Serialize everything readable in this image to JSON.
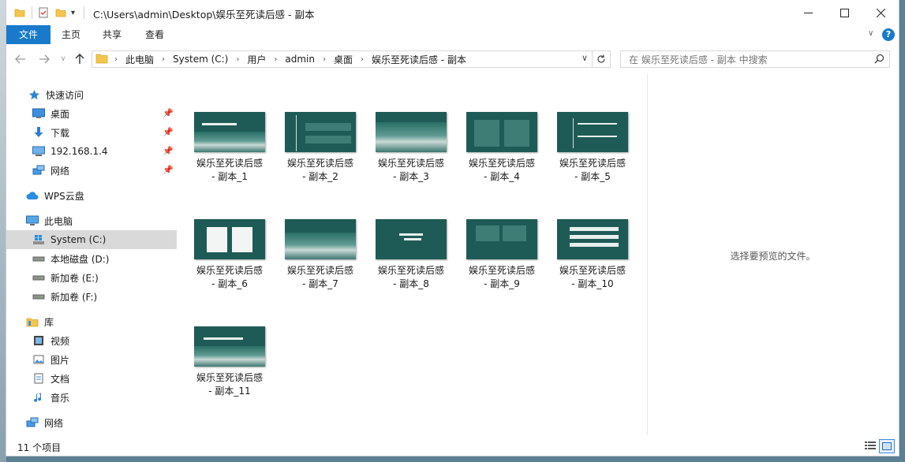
{
  "window": {
    "title": "C:\\Users\\admin\\Desktop\\娱乐至死读后感 - 副本"
  },
  "ribbon": {
    "tabs": [
      {
        "label": "文件",
        "active": true
      },
      {
        "label": "主页"
      },
      {
        "label": "共享"
      },
      {
        "label": "查看"
      }
    ]
  },
  "address": {
    "breadcrumbs": [
      "此电脑",
      "System (C:)",
      "用户",
      "admin",
      "桌面",
      "娱乐至死读后感 - 副本"
    ]
  },
  "search": {
    "placeholder": "在 娱乐至死读后感 - 副本 中搜索"
  },
  "sidebar": {
    "items": [
      {
        "label": "快速访问",
        "icon": "star-icon",
        "indent": 0
      },
      {
        "label": "桌面",
        "icon": "desktop-icon",
        "indent": 1,
        "pinned": true
      },
      {
        "label": "下载",
        "icon": "download-icon",
        "indent": 1,
        "pinned": true
      },
      {
        "label": "192.168.1.4",
        "icon": "monitor-icon",
        "indent": 1,
        "pinned": true
      },
      {
        "label": "网络",
        "icon": "network-icon",
        "indent": 1,
        "pinned": true
      },
      {
        "label": "WPS云盘",
        "icon": "cloud-icon",
        "indent": 0
      },
      {
        "label": "此电脑",
        "icon": "computer-icon",
        "indent": 0
      },
      {
        "label": "System (C:)",
        "icon": "windows-drive-icon",
        "indent": 1,
        "selected": true
      },
      {
        "label": "本地磁盘 (D:)",
        "icon": "drive-icon",
        "indent": 1
      },
      {
        "label": "新加卷 (E:)",
        "icon": "drive-icon",
        "indent": 1
      },
      {
        "label": "新加卷 (F:)",
        "icon": "drive-icon",
        "indent": 1
      },
      {
        "label": "库",
        "icon": "library-icon",
        "indent": 0
      },
      {
        "label": "视频",
        "icon": "video-icon",
        "indent": 1
      },
      {
        "label": "图片",
        "icon": "picture-icon",
        "indent": 1
      },
      {
        "label": "文档",
        "icon": "document-icon",
        "indent": 1
      },
      {
        "label": "音乐",
        "icon": "music-icon",
        "indent": 1
      },
      {
        "label": "网络",
        "icon": "network-icon",
        "indent": 0
      }
    ]
  },
  "files": [
    {
      "line1": "娱乐至死读后感",
      "line2": "- 副本_1"
    },
    {
      "line1": "娱乐至死读后感",
      "line2": "- 副本_2"
    },
    {
      "line1": "娱乐至死读后感",
      "line2": "- 副本_3"
    },
    {
      "line1": "娱乐至死读后感",
      "line2": "- 副本_4"
    },
    {
      "line1": "娱乐至死读后感",
      "line2": "- 副本_5"
    },
    {
      "line1": "娱乐至死读后感",
      "line2": "- 副本_6"
    },
    {
      "line1": "娱乐至死读后感",
      "line2": "- 副本_7"
    },
    {
      "line1": "娱乐至死读后感",
      "line2": "- 副本_8"
    },
    {
      "line1": "娱乐至死读后感",
      "line2": "- 副本_9"
    },
    {
      "line1": "娱乐至死读后感",
      "line2": "- 副本_10"
    },
    {
      "line1": "娱乐至死读后感",
      "line2": "- 副本_11"
    }
  ],
  "preview": {
    "message": "选择要预览的文件。"
  },
  "status": {
    "count_text": "11 个项目"
  },
  "colors": {
    "accent": "#1979ca",
    "selected_row": "#d9d9d9",
    "thumb_bg": "#1f5b56"
  }
}
